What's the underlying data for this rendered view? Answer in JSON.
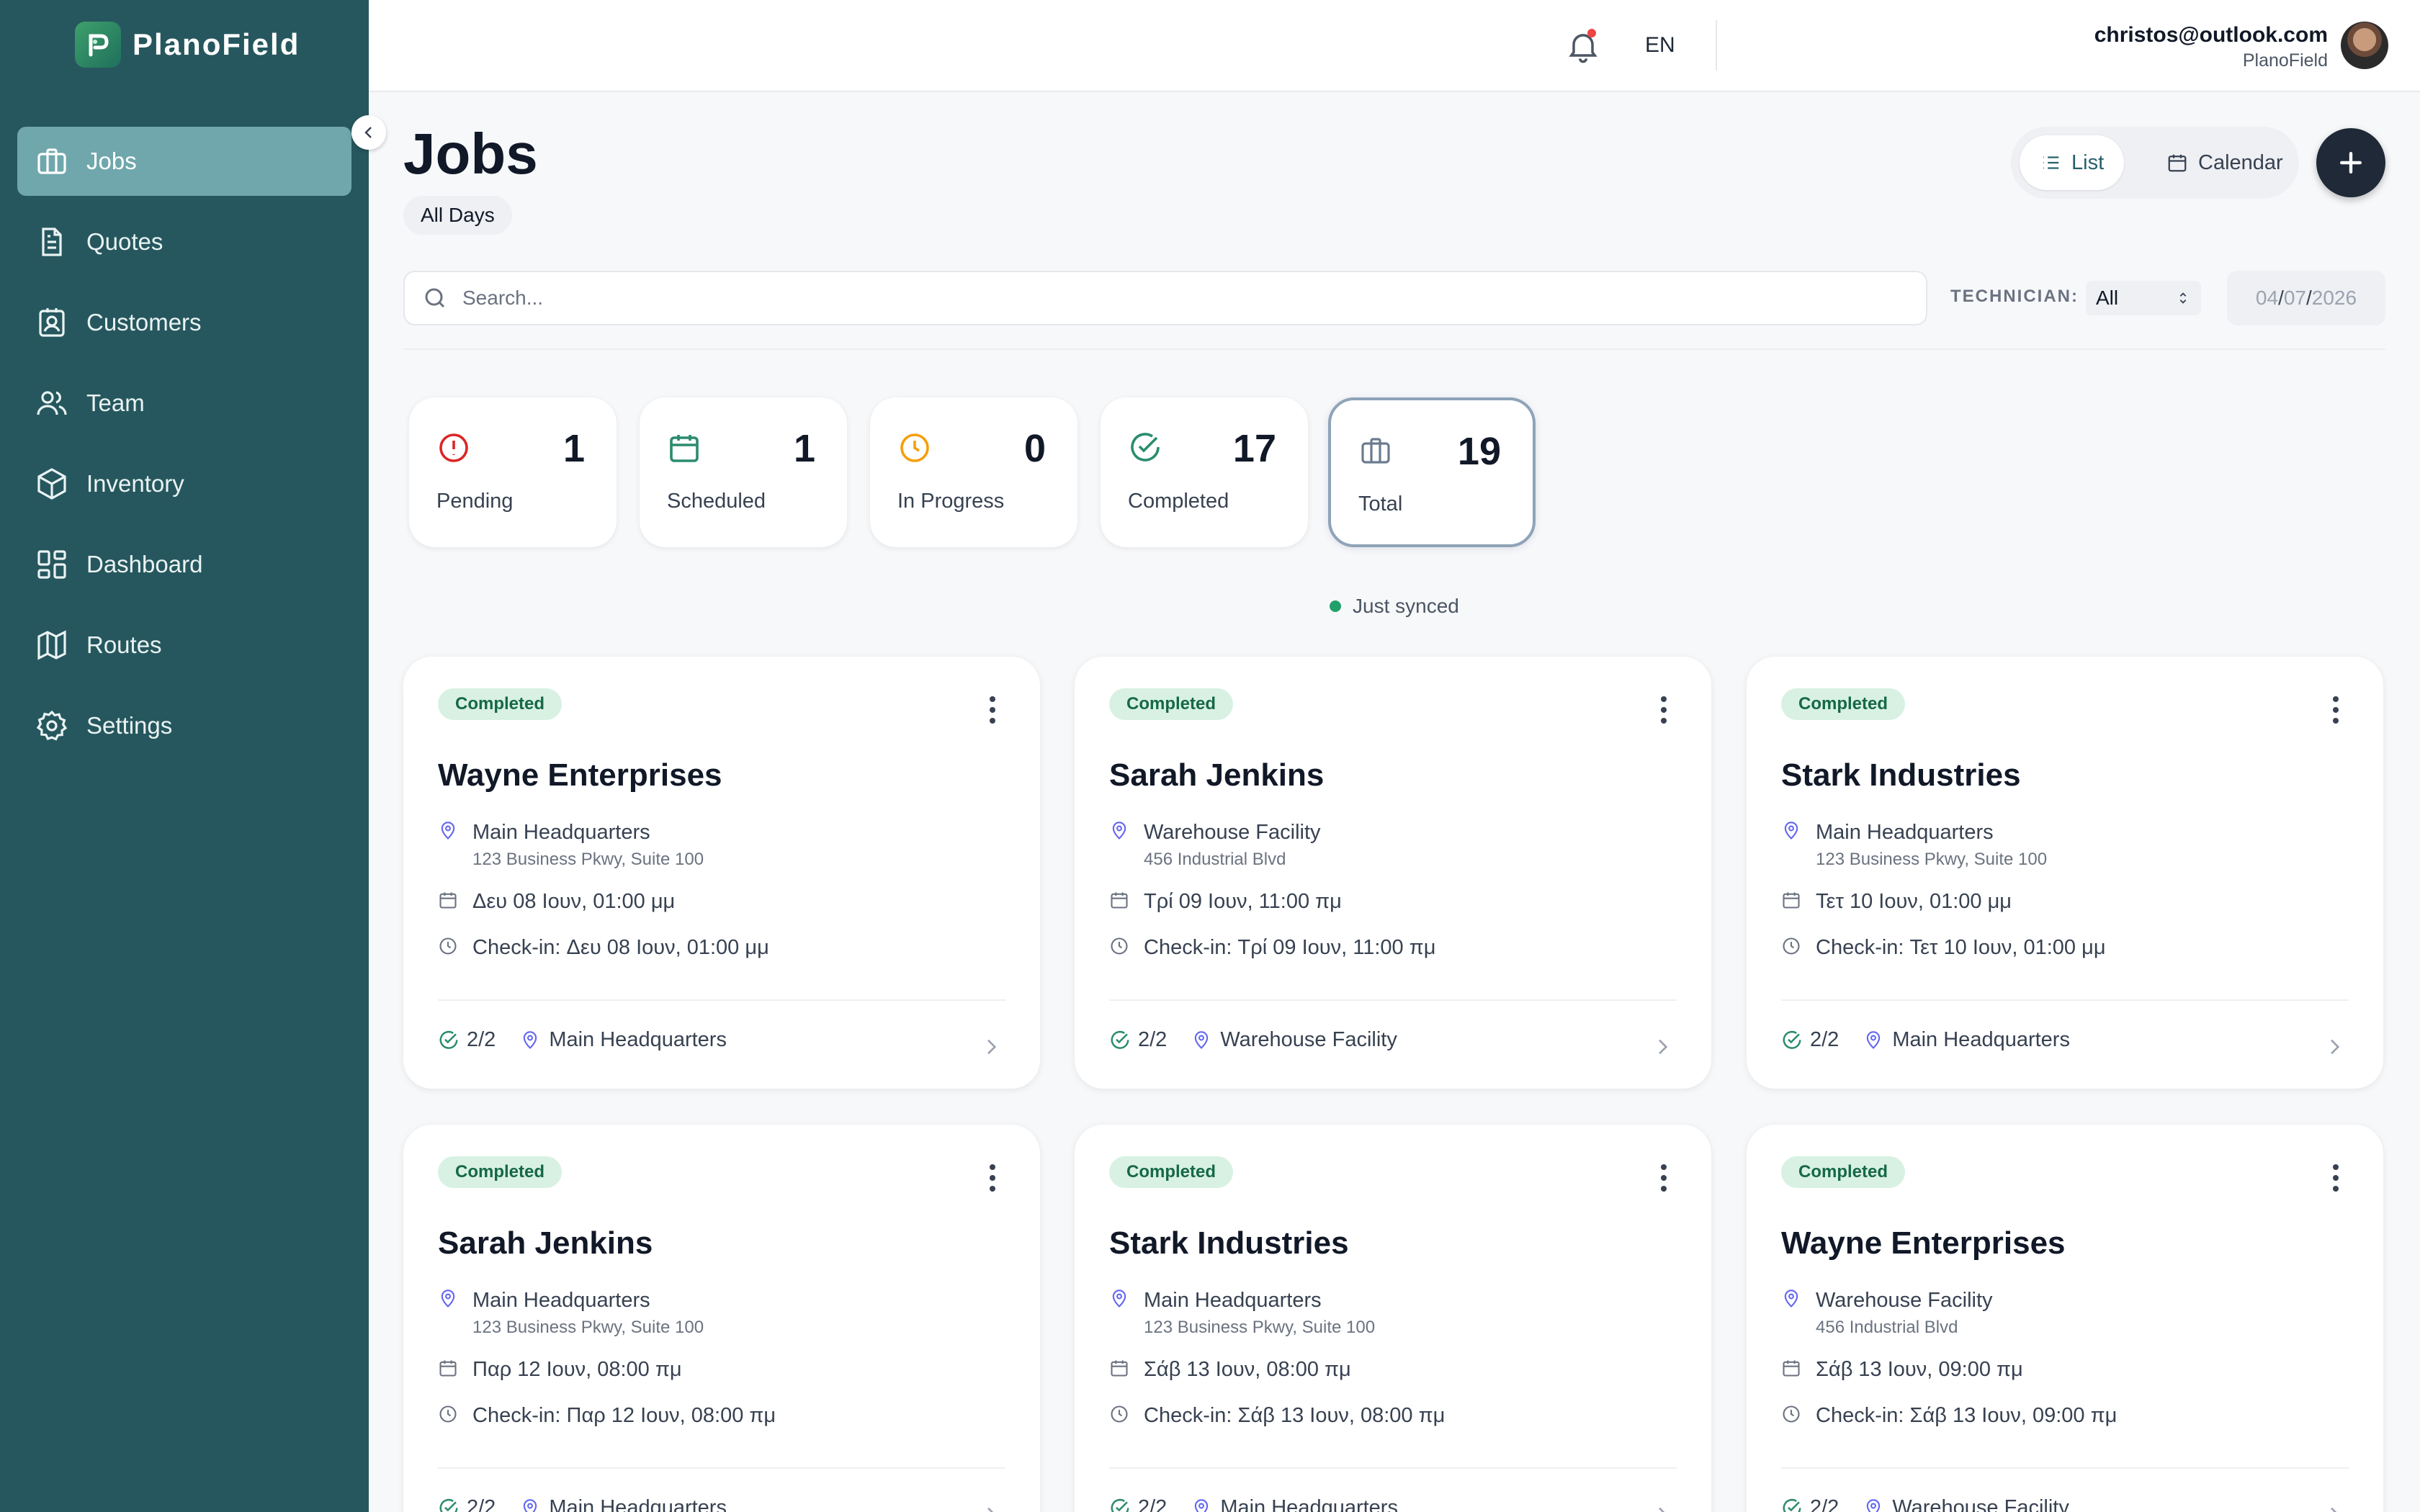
{
  "brand": {
    "name": "PlanoField"
  },
  "sidebar": {
    "items": [
      {
        "label": "Jobs",
        "icon": "briefcase-icon"
      },
      {
        "label": "Quotes",
        "icon": "document-icon"
      },
      {
        "label": "Customers",
        "icon": "contact-card-icon"
      },
      {
        "label": "Team",
        "icon": "users-icon"
      },
      {
        "label": "Inventory",
        "icon": "box-icon"
      },
      {
        "label": "Dashboard",
        "icon": "dashboard-grid-icon"
      },
      {
        "label": "Routes",
        "icon": "map-icon"
      },
      {
        "label": "Settings",
        "icon": "gear-icon"
      }
    ]
  },
  "topbar": {
    "language": "EN",
    "user_email": "christos@outlook.com",
    "user_org": "PlanoField"
  },
  "page": {
    "title": "Jobs",
    "filter_chip": "All Days"
  },
  "view_toggle": {
    "list_label": "List",
    "calendar_label": "Calendar"
  },
  "search": {
    "placeholder": "Search..."
  },
  "technician": {
    "label": "TECHNICIAN:",
    "value": "All"
  },
  "date_filter": {
    "day": "04",
    "month": "07",
    "year": "2026"
  },
  "stats": [
    {
      "label": "Pending",
      "value": "1",
      "color": "#dc2626"
    },
    {
      "label": "Scheduled",
      "value": "1",
      "color": "#2a8c6e"
    },
    {
      "label": "In Progress",
      "value": "0",
      "color": "#f59e0b"
    },
    {
      "label": "Completed",
      "value": "17",
      "color": "#2a8c6e"
    },
    {
      "label": "Total",
      "value": "19",
      "color": "#6b7b8f"
    }
  ],
  "sync_status": "Just synced",
  "jobs": [
    {
      "status": "Completed",
      "customer": "Wayne Enterprises",
      "location": "Main Headquarters",
      "address": "123 Business Pkwy, Suite 100",
      "date": "Δευ 08 Ιουν, 01:00 μμ",
      "checkin": "Check-in: Δευ 08 Ιουν, 01:00 μμ",
      "tasks": "2/2",
      "site": "Main Headquarters"
    },
    {
      "status": "Completed",
      "customer": "Sarah Jenkins",
      "location": "Warehouse Facility",
      "address": "456 Industrial Blvd",
      "date": "Τρί 09 Ιουν, 11:00 πμ",
      "checkin": "Check-in: Τρί 09 Ιουν, 11:00 πμ",
      "tasks": "2/2",
      "site": "Warehouse Facility"
    },
    {
      "status": "Completed",
      "customer": "Stark Industries",
      "location": "Main Headquarters",
      "address": "123 Business Pkwy, Suite 100",
      "date": "Τετ 10 Ιουν, 01:00 μμ",
      "checkin": "Check-in: Τετ 10 Ιουν, 01:00 μμ",
      "tasks": "2/2",
      "site": "Main Headquarters"
    },
    {
      "status": "Completed",
      "customer": "Sarah Jenkins",
      "location": "Main Headquarters",
      "address": "123 Business Pkwy, Suite 100",
      "date": "Παρ 12 Ιουν, 08:00 πμ",
      "checkin": "Check-in: Παρ 12 Ιουν, 08:00 πμ",
      "tasks": "2/2",
      "site": "Main Headquarters"
    },
    {
      "status": "Completed",
      "customer": "Stark Industries",
      "location": "Main Headquarters",
      "address": "123 Business Pkwy, Suite 100",
      "date": "Σάβ 13 Ιουν, 08:00 πμ",
      "checkin": "Check-in: Σάβ 13 Ιουν, 08:00 πμ",
      "tasks": "2/2",
      "site": "Main Headquarters"
    },
    {
      "status": "Completed",
      "customer": "Wayne Enterprises",
      "location": "Warehouse Facility",
      "address": "456 Industrial Blvd",
      "date": "Σάβ 13 Ιουν, 09:00 πμ",
      "checkin": "Check-in: Σάβ 13 Ιουν, 09:00 πμ",
      "tasks": "2/2",
      "site": "Warehouse Facility"
    }
  ]
}
